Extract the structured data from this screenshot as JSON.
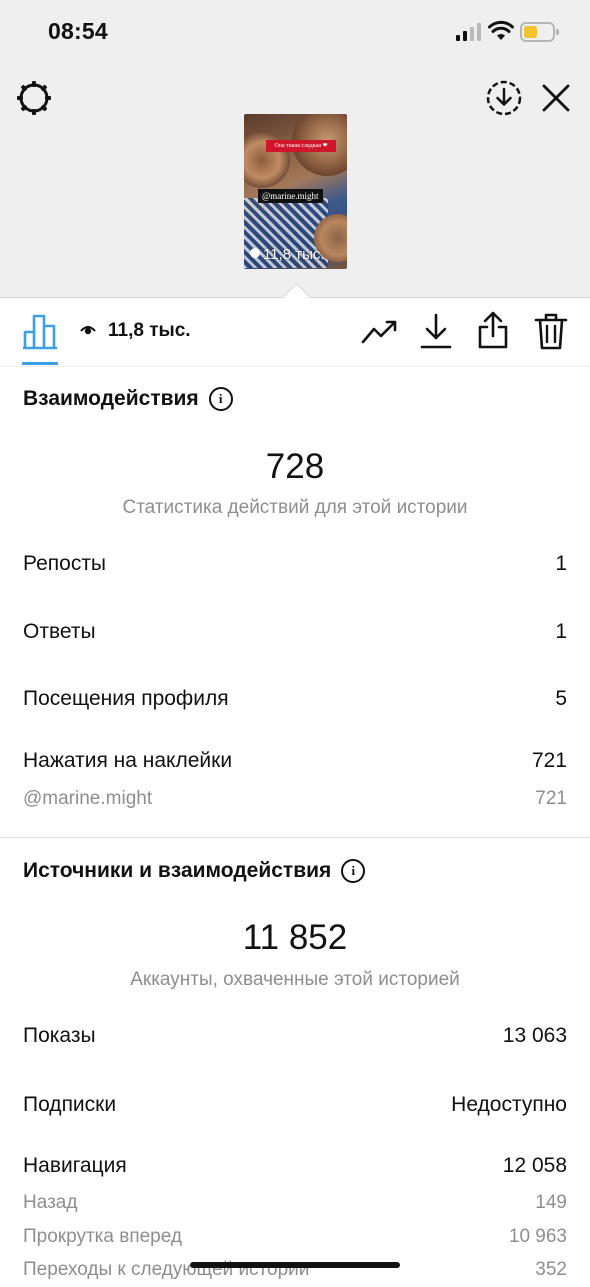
{
  "status_bar": {
    "time": "08:54"
  },
  "story": {
    "caption_text": "Она такая сладкая ❤",
    "mention_text": "@marine.might",
    "views_text": "11,8 тыс."
  },
  "toolbar": {
    "views_count": "11,8 тыс."
  },
  "interactions": {
    "title": "Взаимодействия",
    "total": "728",
    "caption": "Статистика действий для этой истории",
    "rows": [
      {
        "label": "Репосты",
        "value": "1"
      },
      {
        "label": "Ответы",
        "value": "1"
      },
      {
        "label": "Посещения профиля",
        "value": "5"
      },
      {
        "label": "Нажатия на наклейки",
        "value": "721"
      }
    ],
    "sub_rows": [
      {
        "label": "@marine.might",
        "value": "721"
      }
    ]
  },
  "discovery": {
    "title": "Источники и взаимодействия",
    "total": "11 852",
    "caption": "Аккаунты, охваченные этой историей",
    "rows": [
      {
        "label": "Показы",
        "value": "13 063"
      },
      {
        "label": "Подписки",
        "value": "Недоступно"
      },
      {
        "label": "Навигация",
        "value": "12 058"
      }
    ],
    "sub_rows": [
      {
        "label": "Назад",
        "value": "149"
      },
      {
        "label": "Прокрутка вперед",
        "value": "10 963"
      },
      {
        "label": "Переходы к следующей истории",
        "value": "352"
      }
    ]
  },
  "colors": {
    "accent": "#3aa1e6",
    "muted_text": "#8e8e8e",
    "header_bg": "#efefef"
  }
}
